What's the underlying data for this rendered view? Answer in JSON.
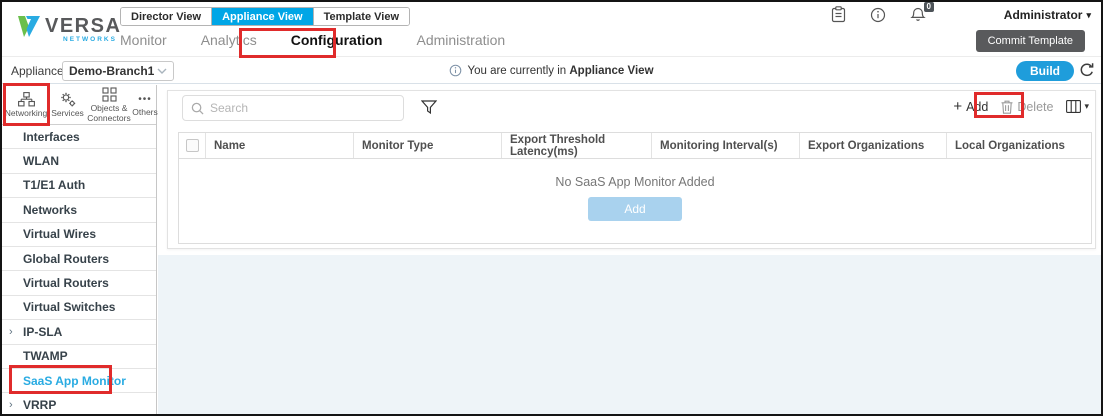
{
  "brand": {
    "name": "VERSA",
    "sub": "NETWORKS"
  },
  "header": {
    "view_tabs": [
      {
        "label": "Director View",
        "active": false
      },
      {
        "label": "Appliance View",
        "active": true
      },
      {
        "label": "Template View",
        "active": false
      }
    ],
    "nav": [
      {
        "label": "Monitor",
        "active": false
      },
      {
        "label": "Analytics",
        "active": false
      },
      {
        "label": "Configuration",
        "active": true
      },
      {
        "label": "Administration",
        "active": false
      }
    ],
    "notifications_badge": "0",
    "user_menu": "Administrator",
    "commit_button": "Commit Template"
  },
  "appliance_bar": {
    "label": "Appliance",
    "selected_appliance": "Demo-Branch1",
    "notice_prefix": "You are currently in",
    "notice_bold": "Appliance View",
    "build_button": "Build"
  },
  "sidebar": {
    "categories": [
      {
        "label": "Networking",
        "icon": "network-nodes-icon",
        "selected": true
      },
      {
        "label": "Services",
        "icon": "gears-icon",
        "selected": false
      },
      {
        "label": "Objects & Connectors",
        "icon": "squares-icon",
        "selected": false
      },
      {
        "label": "Others",
        "icon": "ellipsis-icon",
        "selected": false
      }
    ],
    "items": [
      {
        "label": "Interfaces"
      },
      {
        "label": "WLAN"
      },
      {
        "label": "T1/E1 Auth"
      },
      {
        "label": "Networks"
      },
      {
        "label": "Virtual Wires"
      },
      {
        "label": "Global Routers"
      },
      {
        "label": "Virtual Routers"
      },
      {
        "label": "Virtual Switches"
      },
      {
        "label": "IP-SLA",
        "expandable": true
      },
      {
        "label": "TWAMP"
      },
      {
        "label": "SaaS App Monitor",
        "selected": true
      },
      {
        "label": "VRRP",
        "expandable": true
      }
    ]
  },
  "toolbar": {
    "search_placeholder": "Search",
    "add_label": "Add",
    "delete_label": "Delete"
  },
  "table": {
    "columns": [
      "Name",
      "Monitor Type",
      "Export Threshold Latency(ms)",
      "Monitoring Interval(s)",
      "Export Organizations",
      "Local Organizations"
    ],
    "empty_message": "No SaaS App Monitor Added",
    "empty_add_label": "Add"
  },
  "icons": {
    "plus": "+",
    "ellipsis": "•••",
    "caret_down": "▾",
    "chevron_right": "›"
  },
  "colors": {
    "accent_blue": "#00a6e6",
    "build_blue": "#1f9ddb",
    "selected_item_blue": "#29abe2",
    "empty_add_blue": "#a9d2ee",
    "commit_gray": "#595a5c",
    "highlight_red": "#e02b2b"
  },
  "annotations": [
    "configuration-tab-highlight",
    "networking-category-highlight",
    "saas-app-monitor-highlight",
    "add-button-highlight"
  ]
}
